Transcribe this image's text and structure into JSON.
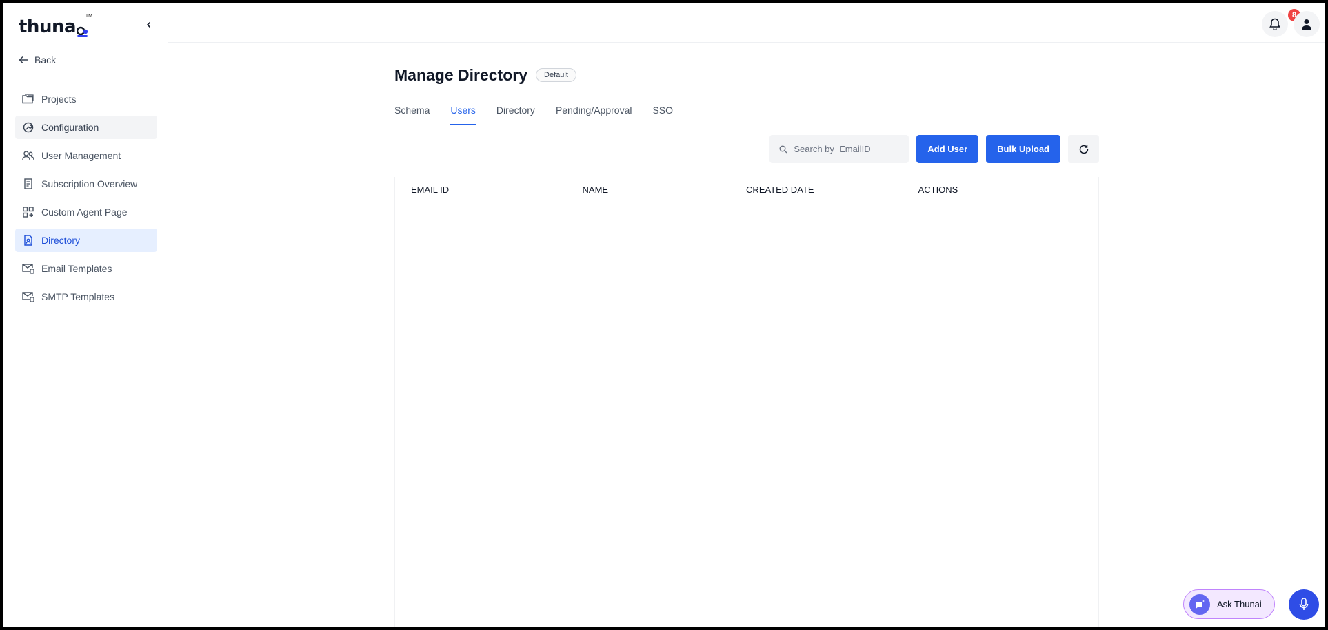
{
  "app": {
    "logo_text": "thuna",
    "logo_tm": "TM",
    "back_label": "Back"
  },
  "sidebar": {
    "items": [
      {
        "label": "Projects",
        "icon": "folders-icon"
      },
      {
        "label": "Configuration",
        "icon": "config-icon"
      },
      {
        "label": "User Management",
        "icon": "users-icon"
      },
      {
        "label": "Subscription Overview",
        "icon": "receipt-icon"
      },
      {
        "label": "Custom Agent Page",
        "icon": "grid-plus-icon"
      },
      {
        "label": "Directory",
        "icon": "document-user-icon"
      },
      {
        "label": "Email Templates",
        "icon": "mail-template-icon"
      },
      {
        "label": "SMTP Templates",
        "icon": "mail-template-icon"
      }
    ]
  },
  "topbar": {
    "notification_count": "8"
  },
  "page": {
    "title": "Manage Directory",
    "tag": "Default",
    "tabs": [
      "Schema",
      "Users",
      "Directory",
      "Pending/Approval",
      "SSO"
    ],
    "active_tab": "Users"
  },
  "toolbar": {
    "search_placeholder": "Search by  EmailID",
    "add_user_label": "Add User",
    "bulk_upload_label": "Bulk Upload"
  },
  "table": {
    "columns": [
      "EMAIL ID",
      "NAME",
      "CREATED DATE",
      "ACTIONS"
    ],
    "rows": []
  },
  "assistant": {
    "ask_label": "Ask Thunai"
  },
  "colors": {
    "accent": "#2563eb",
    "active_nav_bg": "#e6efff",
    "badge": "#ef4444"
  }
}
